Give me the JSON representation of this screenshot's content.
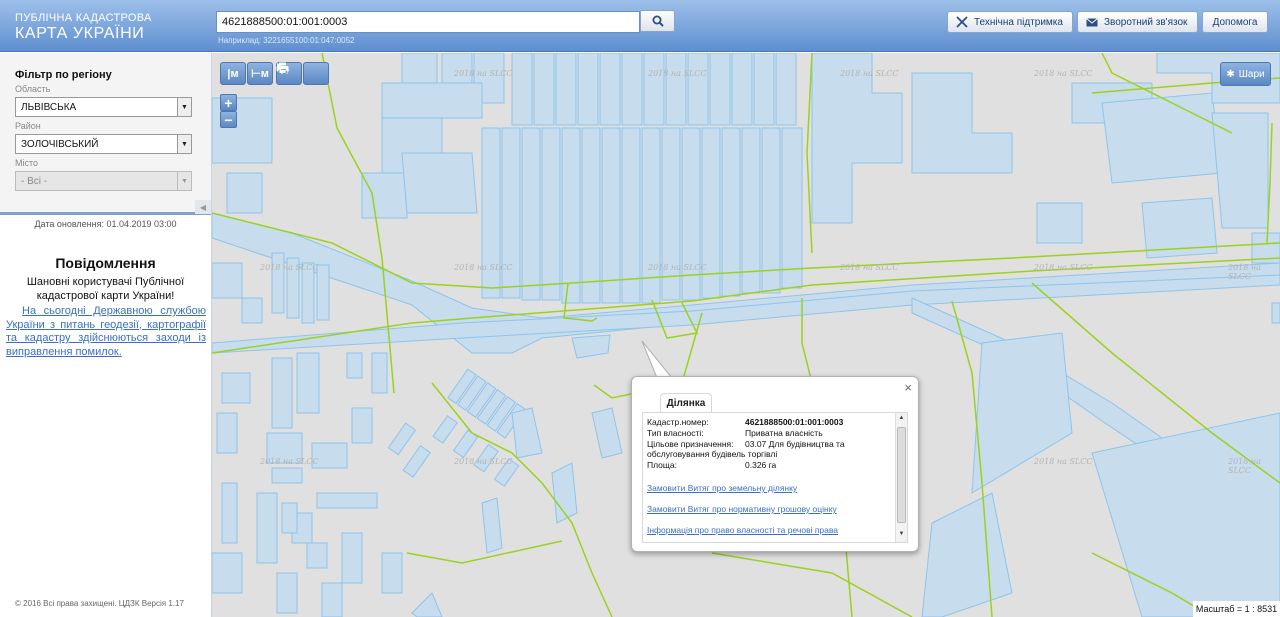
{
  "header": {
    "logo_line1": "ПУБЛІЧНА КАДАСТРОВА",
    "logo_line2": "КАРТА УКРАЇНИ",
    "search_value": "4621888500:01:001:0003",
    "search_example": "Наприклад: 3221655100:01:047:0052",
    "buttons": {
      "support": "Технічна підтримка",
      "feedback": "Зворотний зв'язок",
      "help": "Допомога"
    }
  },
  "sidebar": {
    "filter_title": "Фільтр по регіону",
    "oblast_label": "Область",
    "oblast_value": "ЛЬВІВСЬКА",
    "raion_label": "Район",
    "raion_value": "ЗОЛОЧІВСЬКИЙ",
    "misto_label": "Місто",
    "misto_value": "- Всі -",
    "update_date": "Дата оновлення: 01.04.2019 03:00",
    "notices_title": "Повідомлення",
    "notices_greeting": "Шановні користувачі Публічної кадастрової карти України!",
    "notices_link": "На сьогодні Державною службою України з питань геодезії, картографії та кадастру здійснюються заходи із виправлення помилок.",
    "copyright": "© 2016 Всі права захищені. ЦДЗК Версія 1.17"
  },
  "map": {
    "layers_label": "Шари",
    "scale_text": "Масштаб = 1 : 8531",
    "watermark": "2018 на SLCC",
    "colors": {
      "background": "#e0e0e0",
      "parcel_fill": "#c7dcec",
      "parcel_stroke": "#8ec4ec",
      "boundary": "#9bd21e"
    },
    "toolbar": {
      "measure_line": "|м",
      "measure_area": "⊢м",
      "print": "print-icon",
      "info": "info-cursor-icon"
    }
  },
  "popup": {
    "tab": "Ділянка",
    "rows": [
      {
        "label": "Кадастр.номер:",
        "value": "4621888500:01:001:0003"
      },
      {
        "label": "Тип власності:",
        "value": "Приватна власність"
      },
      {
        "label": "Цільове призначення:",
        "value": "03.07 Для будівництва та"
      },
      {
        "label": "",
        "value": "обслуговування будівель торгівлі"
      },
      {
        "label": "Площа:",
        "value": "0.326 га"
      }
    ],
    "links": [
      "Замовити Витяг про земельну ділянку",
      "Замовити Витяг про нормативну грошову оцінку",
      "Інформація про право власності та речові права"
    ]
  }
}
